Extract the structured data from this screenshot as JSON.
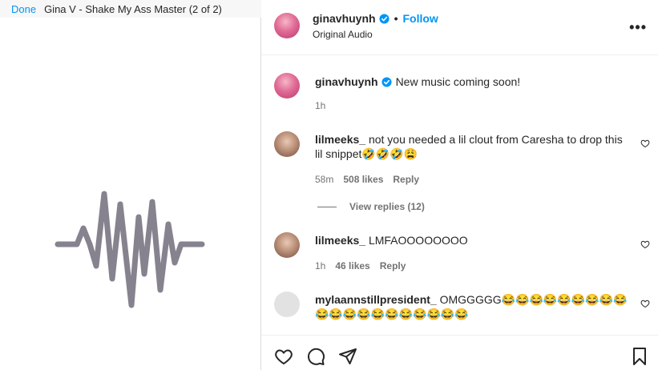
{
  "media": {
    "done_label": "Done",
    "title": "Gina V - Shake My Ass Master (2 of 2)"
  },
  "header": {
    "username": "ginavhuynh",
    "separator": "•",
    "follow_label": "Follow",
    "subtitle": "Original Audio",
    "more_icon": "more-horizontal-icon"
  },
  "caption": {
    "username": "ginavhuynh",
    "text": "New music coming soon!",
    "time": "1h"
  },
  "comments": [
    {
      "username": "lilmeeks_",
      "text": "not you needed a lil clout from Caresha to drop this lil snippet🤣🤣🤣😩",
      "time": "58m",
      "likes": "508 likes",
      "reply": "Reply",
      "view_replies": "View replies (12)"
    },
    {
      "username": "lilmeeks_",
      "text": "LMFAOOOOOOOO",
      "time": "1h",
      "likes": "46 likes",
      "reply": "Reply"
    },
    {
      "username": "mylaannstillpresident_",
      "text": "OMGGGGG😂😂😂😂😂😂😂😂😂😂😂😂😂😂😂😂😂😂😂😂"
    }
  ],
  "colors": {
    "accent": "#0095f6",
    "verified": "#0095f6",
    "muted": "#737373"
  }
}
